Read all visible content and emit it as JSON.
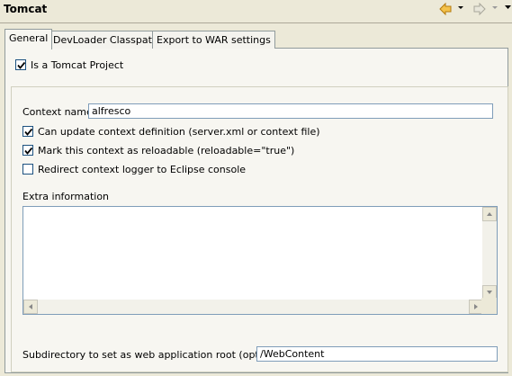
{
  "view": {
    "title": "Tomcat",
    "nav_icons": [
      "back-arrow-icon",
      "dropdown-icon",
      "forward-arrow-icon",
      "dropdown-icon",
      "view-menu-icon"
    ]
  },
  "tabs": [
    {
      "label": "General",
      "active": true
    },
    {
      "label": "DevLoader Classpath",
      "active": false
    },
    {
      "label": "Export to WAR settings",
      "active": false
    }
  ],
  "project": {
    "is_tomcat_label": "Is a Tomcat Project",
    "is_tomcat_checked": true
  },
  "context": {
    "name_label": "Context name",
    "name_value": "alfresco",
    "options": [
      {
        "label": "Can update context definition (server.xml or context file)",
        "checked": true
      },
      {
        "label": "Mark this context as reloadable (reloadable=\"true\")",
        "checked": true
      },
      {
        "label": "Redirect context logger to Eclipse console",
        "checked": false
      }
    ],
    "extra_label": "Extra information",
    "extra_value": "",
    "subdir_label": "Subdirectory to set as web application root (optional)",
    "subdir_value": "/WebContent"
  },
  "colors": {
    "background": "#ece9d8",
    "panel": "#f7f6f1",
    "checkbox_border": "#1c5180",
    "checkmark": "#21a121",
    "field_border": "#7f9db9",
    "nav_arrow": "#e3a21a"
  }
}
